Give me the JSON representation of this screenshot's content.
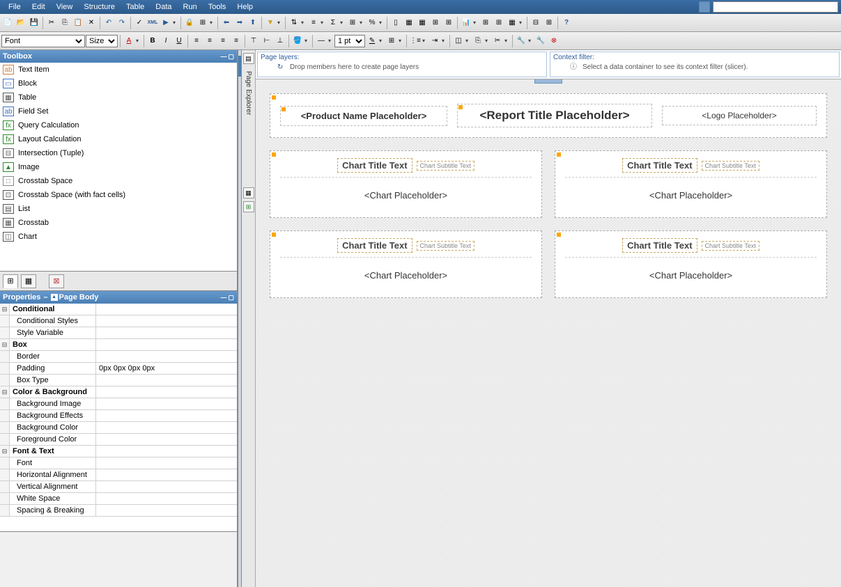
{
  "menu": [
    "File",
    "Edit",
    "View",
    "Structure",
    "Table",
    "Data",
    "Run",
    "Tools",
    "Help"
  ],
  "toolbar2": {
    "font_label": "Font",
    "size_label": "Size",
    "pt_label": "1 pt"
  },
  "toolbox": {
    "title": "Toolbox",
    "items": [
      {
        "icon": "ab",
        "color": "#d08040",
        "label": "Text Item"
      },
      {
        "icon": "▭",
        "color": "#4070c0",
        "label": "Block"
      },
      {
        "icon": "▦",
        "color": "#555",
        "label": "Table"
      },
      {
        "icon": "ab",
        "color": "#4070c0",
        "label": "Field Set"
      },
      {
        "icon": "fx",
        "color": "#2a8a2a",
        "label": "Query Calculation"
      },
      {
        "icon": "fx",
        "color": "#2a8a2a",
        "label": "Layout Calculation"
      },
      {
        "icon": "⊟",
        "color": "#555",
        "label": "Intersection (Tuple)"
      },
      {
        "icon": "▲",
        "color": "#2a8a2a",
        "label": "Image"
      },
      {
        "icon": "□",
        "color": "#888",
        "label": "Crosstab Space"
      },
      {
        "icon": "⊡",
        "color": "#555",
        "label": "Crosstab Space (with fact cells)"
      },
      {
        "icon": "▤",
        "color": "#555",
        "label": "List"
      },
      {
        "icon": "▦",
        "color": "#555",
        "label": "Crosstab"
      },
      {
        "icon": "◫",
        "color": "#555",
        "label": "Chart"
      }
    ]
  },
  "properties": {
    "title": "Properties",
    "context": "Page Body",
    "rows": [
      {
        "type": "cat",
        "name": "Conditional"
      },
      {
        "type": "sub",
        "name": "Conditional Styles",
        "val": ""
      },
      {
        "type": "sub",
        "name": "Style Variable",
        "val": ""
      },
      {
        "type": "cat",
        "name": "Box"
      },
      {
        "type": "sub",
        "name": "Border",
        "val": ""
      },
      {
        "type": "sub",
        "name": "Padding",
        "val": "0px 0px 0px 0px"
      },
      {
        "type": "sub",
        "name": "Box Type",
        "val": ""
      },
      {
        "type": "cat",
        "name": "Color & Background"
      },
      {
        "type": "sub",
        "name": "Background Image",
        "val": ""
      },
      {
        "type": "sub",
        "name": "Background Effects",
        "val": ""
      },
      {
        "type": "sub",
        "name": "Background Color",
        "val": ""
      },
      {
        "type": "sub",
        "name": "Foreground Color",
        "val": ""
      },
      {
        "type": "cat",
        "name": "Font & Text"
      },
      {
        "type": "sub",
        "name": "Font",
        "val": ""
      },
      {
        "type": "sub",
        "name": "Horizontal Alignment",
        "val": ""
      },
      {
        "type": "sub",
        "name": "Vertical Alignment",
        "val": ""
      },
      {
        "type": "sub",
        "name": "White Space",
        "val": ""
      },
      {
        "type": "sub",
        "name": "Spacing & Breaking",
        "val": ""
      }
    ]
  },
  "explorer": {
    "label": "Page Explorer"
  },
  "dropzones": {
    "layers": {
      "title": "Page layers:",
      "hint": "Drop members here to create page layers"
    },
    "filter": {
      "title": "Context filter:",
      "hint": "Select a data container to see its context filter (slicer)."
    }
  },
  "report": {
    "product": "<Product Name Placeholder>",
    "title": "<Report Title Placeholder>",
    "logo": "<Logo Placeholder>",
    "chart_title": "Chart Title Text",
    "chart_subtitle": "Chart Subtitle Text",
    "chart_ph": "<Chart Placeholder>"
  }
}
